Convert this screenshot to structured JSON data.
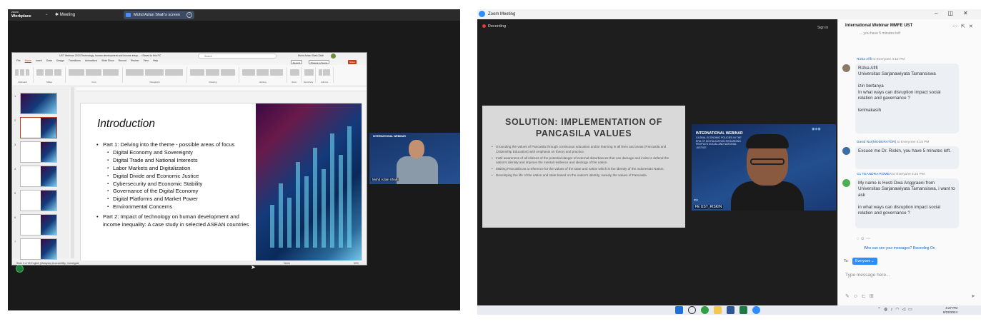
{
  "left_window": {
    "brand_small": "zoom",
    "brand": "Workplace",
    "meeting_label": "Meeting",
    "share_label": "Mohd Azlan Shah's screen",
    "ppt": {
      "title": "UST Webinar 2024 Technology, human development and income inequ... • Saved to this PC",
      "search": "Search",
      "user": "Mohd Azlan Shah Zaidi",
      "menu": [
        "File",
        "Home",
        "Insert",
        "Draw",
        "Design",
        "Transitions",
        "Animations",
        "Slide Show",
        "Record",
        "Review",
        "View",
        "Help"
      ],
      "record_btn": "Record",
      "present_btn": "Present in Teams",
      "share_btn": "Share",
      "ribbon_groups": [
        "Clipboard",
        "Slides",
        "Font",
        "Paragraph",
        "Drawing",
        "Editing",
        "Voice",
        "Sensitivity",
        "Add-ins"
      ],
      "thumb_numbers": [
        "1",
        "2",
        "3",
        "4",
        "5",
        "6",
        "7"
      ],
      "status": "Slide 2 of 33    English (Malaysia)    Accessibility: Investigate",
      "status_right": "Notes",
      "zoom": "60%",
      "slide": {
        "title": "Introduction",
        "bullets": [
          {
            "level": 1,
            "text": "Part 1: Delving into the theme - possible areas of focus"
          },
          {
            "level": 2,
            "text": "Digital Economy and Sovereignty"
          },
          {
            "level": 2,
            "text": "Digital Trade and National Interests"
          },
          {
            "level": 2,
            "text": "Labor Markets and Digitalization"
          },
          {
            "level": 2,
            "text": "Digital Divide and Economic Justice"
          },
          {
            "level": 2,
            "text": "Cybersecurity and Economic Stability"
          },
          {
            "level": 2,
            "text": "Governance of the Digital Economy"
          },
          {
            "level": 2,
            "text": "Digital Platforms and Market Power"
          },
          {
            "level": 2,
            "text": "Environmental Concerns"
          },
          {
            "level": 1,
            "text": "Part 2: Impact of technology on human development and income inequality: A case study in selected ASEAN countries"
          }
        ]
      }
    },
    "participant": {
      "tag": "INTERNATIONAL WEBINAR",
      "name": "Mohd Azlan Shah"
    }
  },
  "right_window": {
    "title": "Zoom Meeting",
    "recording": "Recording",
    "sign_in": "Sign in",
    "slide": {
      "title_line1": "SOLUTION: IMPLEMENTATION OF",
      "title_line2": "PANCASILA VALUES",
      "bullets": [
        "Grounding the values of Pancasila through continuous education and/or learning in all lines and areas (Pancasila and Citizenship Education) with emphasis on theory and practice.",
        "Instil awareness of all citizens of the potential danger of external disturbances that can damage and invite to defend the nation's identity and improve the mental resilience and ideology of the nation.",
        "Making Pancasila as a reference for the values of the state and nation which is the identity of the Indonesian Nation.",
        "Developing the life of the nation and state based on the nation's identity, namely the values of Pancasila."
      ]
    },
    "speaker": {
      "tag": "INTERNATIONAL WEBINAR",
      "subtitle": "GLOBAL ECONOMIC POLICIES IN THE ERA OF DIGITALIZATION REGARDING PEOPLE'S SOCIAL AND NATIONAL JUSTICE",
      "pv": "PV",
      "name": "FE UST_RISKIN"
    },
    "chat": {
      "title": "International Webinar MMFE UST",
      "cut_text": "... you have 5 minutes left",
      "messages": [
        {
          "sender": "Rizka Afifi",
          "to": "to Everyone",
          "time": "4:12 PM",
          "lines": [
            "Rizka Afifi",
            "Universitas Sarjanawiyata Tamansiswa",
            "",
            "izin bertanya",
            "In what ways can disruption impact social relation and gavernance ?",
            "",
            "terimakasih"
          ]
        },
        {
          "sender": "David Nur(MODERATOR)",
          "to": "to Everyone",
          "time": "4:15 PM",
          "lines": [
            "Excuse me Dr. Riskin, you have 5 minutes left."
          ]
        },
        {
          "sender": "C1 TEANDRA ROMEA",
          "to": "to Everyone",
          "time": "4:21 PM",
          "lines": [
            "My name is Hesti Dwa Anggraeni from Universitas Sarjanawiyata Tamansiswa, i want to ask",
            "",
            "in what ways can disruption impact social relation and governance ?"
          ]
        }
      ],
      "who_can_see": "Who can see your messages? Recording On",
      "to_label": "To:",
      "everyone": "Everyone",
      "placeholder": "Type message here..."
    },
    "taskbar": {
      "time": "4:27 PM",
      "date": "8/22/2024"
    }
  }
}
